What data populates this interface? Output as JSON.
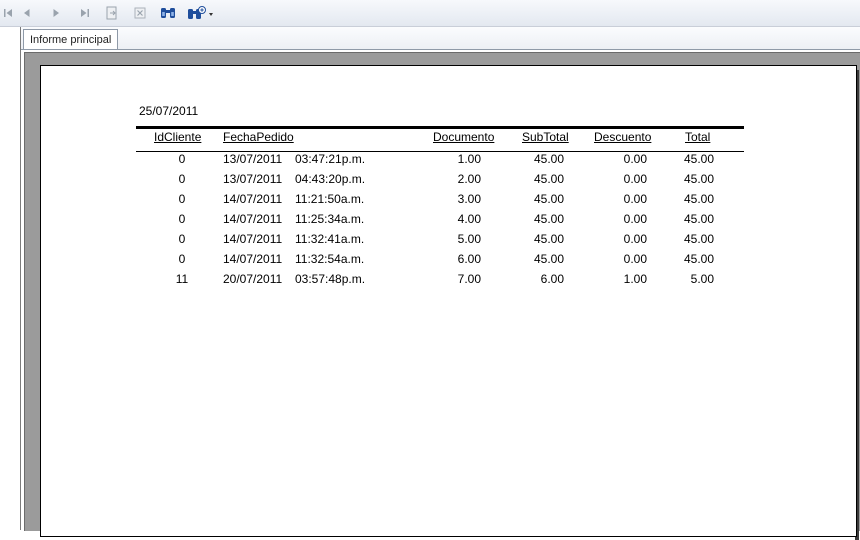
{
  "toolbar": {
    "buttons": [
      {
        "name": "first-page-icon"
      },
      {
        "name": "previous-page-icon"
      },
      {
        "name": "next-page-icon"
      },
      {
        "name": "last-page-icon"
      },
      {
        "name": "export-icon"
      },
      {
        "name": "close-current-view-icon"
      },
      {
        "name": "find-icon"
      },
      {
        "name": "zoom-dropdown-icon"
      }
    ]
  },
  "tabs": [
    {
      "label": "Informe principal"
    }
  ],
  "report": {
    "date": "25/07/2011",
    "columns": [
      "IdCliente",
      "FechaPedido",
      "Documento",
      "SubTotal",
      "Descuento",
      "Total"
    ],
    "rows": [
      {
        "id": "0",
        "fecha": "13/07/2011",
        "hora": "03:47:21p.m.",
        "documento": "1.00",
        "subtotal": "45.00",
        "descuento": "0.00",
        "total": "45.00"
      },
      {
        "id": "0",
        "fecha": "13/07/2011",
        "hora": "04:43:20p.m.",
        "documento": "2.00",
        "subtotal": "45.00",
        "descuento": "0.00",
        "total": "45.00"
      },
      {
        "id": "0",
        "fecha": "14/07/2011",
        "hora": "11:21:50a.m.",
        "documento": "3.00",
        "subtotal": "45.00",
        "descuento": "0.00",
        "total": "45.00"
      },
      {
        "id": "0",
        "fecha": "14/07/2011",
        "hora": "11:25:34a.m.",
        "documento": "4.00",
        "subtotal": "45.00",
        "descuento": "0.00",
        "total": "45.00"
      },
      {
        "id": "0",
        "fecha": "14/07/2011",
        "hora": "11:32:41a.m.",
        "documento": "5.00",
        "subtotal": "45.00",
        "descuento": "0.00",
        "total": "45.00"
      },
      {
        "id": "0",
        "fecha": "14/07/2011",
        "hora": "11:32:54a.m.",
        "documento": "6.00",
        "subtotal": "45.00",
        "descuento": "0.00",
        "total": "45.00"
      },
      {
        "id": "11",
        "fecha": "20/07/2011",
        "hora": "03:57:48p.m.",
        "documento": "7.00",
        "subtotal": "6.00",
        "descuento": "1.00",
        "total": "5.00"
      }
    ]
  },
  "colors": {
    "preview_bg": "#9b9b9b",
    "page_bg": "#ffffff",
    "find_icon": "#1f4e9c"
  }
}
